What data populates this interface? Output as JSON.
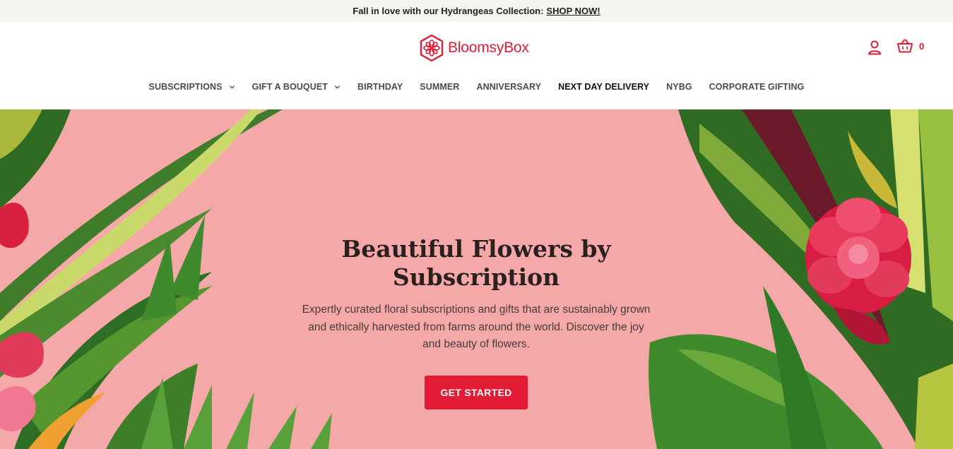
{
  "promo": {
    "text": "Fall in love with our Hydrangeas Collection:",
    "link": "SHOP NOW!"
  },
  "header": {
    "logo_text": "BloomsyBox",
    "logo_icon": "flower-emblem-icon",
    "account_icon": "user-icon",
    "cart_icon": "basket-icon",
    "cart_count": "0"
  },
  "nav": {
    "items": [
      {
        "label": "SUBSCRIPTIONS",
        "dropdown": true
      },
      {
        "label": "GIFT A BOUQUET",
        "dropdown": true
      },
      {
        "label": "BIRTHDAY"
      },
      {
        "label": "SUMMER"
      },
      {
        "label": "ANNIVERSARY"
      },
      {
        "label": "NEXT DAY DELIVERY",
        "active": true
      },
      {
        "label": "NYBG"
      },
      {
        "label": "CORPORATE GIFTING"
      }
    ]
  },
  "hero": {
    "title": "Beautiful Flowers by Subscription",
    "text": "Expertly curated floral subscriptions and gifts that are sustainably grown and ethically harvested from farms around the world. Discover the joy and beauty of flowers.",
    "cta_label": "GET STARTED"
  },
  "colors": {
    "brand": "#e31b35",
    "hero_bg": "#f4a8a8",
    "promo_bg": "#f7f5f1"
  }
}
